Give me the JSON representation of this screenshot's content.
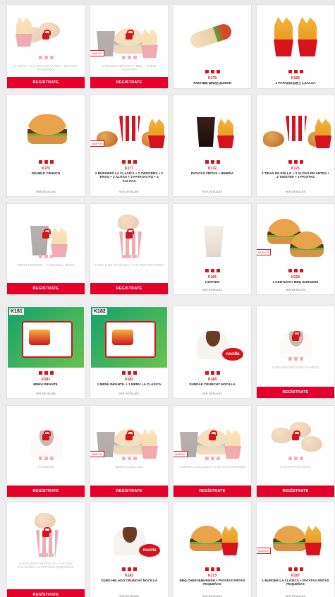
{
  "colors": {
    "accent": "#e4002b",
    "brand_red": "#d6121f",
    "background": "#eeeeee"
  },
  "register_label": "REGÍSTRATE",
  "more_info_label": "VER DETALLES",
  "new_label": "NUEVO",
  "products": [
    {
      "id": "p1",
      "code": "",
      "name": "2 TIRAS + 2 ALITAS PICANTES + PATATAS PEQUEÑAS",
      "locked": true,
      "cta": true,
      "art": "chicken-fries"
    },
    {
      "id": "p2",
      "code": "",
      "name": "2 MENÚS KENTUCKY BBQ + 2 MINI SUNDAES",
      "locked": true,
      "cta": true,
      "new": true,
      "art": "burger-meal"
    },
    {
      "id": "p3",
      "code": "K179",
      "name": "TWISTER WRAP JUNIOR",
      "locked": false,
      "cta": false,
      "art": "wrap"
    },
    {
      "id": "p4",
      "code": "K165",
      "name": "2 PATATAS GR + 1 SALSA",
      "locked": false,
      "cta": false,
      "art": "fries"
    },
    {
      "id": "p5",
      "code": "K175",
      "name": "DOUBLE CRUNCH",
      "locked": false,
      "cta": false,
      "art": "burger"
    },
    {
      "id": "p6",
      "code": "K177",
      "name": "2 BURGERS LA CLÁSICA + 2 TWISTERS + 2 TIRAS + 2 ALITAS + 2 PATATAS PQ + 2 SALSAS",
      "locked": false,
      "cta": false,
      "new": true,
      "art": "bucket-meal"
    },
    {
      "id": "p7",
      "code": "K172",
      "name": "PATATAS FRITAS + BEBIDA",
      "locked": false,
      "cta": false,
      "art": "drink-fries"
    },
    {
      "id": "p8",
      "code": "K171",
      "name": "2 TIRAS DE POLLO + 2 ALITAS PICANTES + 2 TWISTER + 2 PATATAS",
      "locked": false,
      "cta": false,
      "art": "bucket-meal"
    },
    {
      "id": "p9",
      "code": "",
      "name": "MENÚ TWISTER + 2 ORIGINAL BITES",
      "locked": true,
      "cta": true,
      "art": "drink-fries"
    },
    {
      "id": "p10",
      "code": "",
      "name": "2 TIRAS DE PECHUGA + 2 ALITAS PICANTES",
      "locked": true,
      "cta": true,
      "art": "bucket"
    },
    {
      "id": "p11",
      "code": "K166",
      "name": "1 BATIDO",
      "locked": false,
      "cta": false,
      "art": "shake"
    },
    {
      "id": "p12",
      "code": "K159",
      "name": "2 KENTUCKY BBQ BURGERS",
      "locked": false,
      "cta": false,
      "new": true,
      "art": "burgers"
    },
    {
      "id": "p13",
      "code": "K181",
      "name": "MENÚ INFANTIL",
      "locked": false,
      "cta": false,
      "art": "kids",
      "kid_tag": "K181"
    },
    {
      "id": "p14",
      "code": "K182",
      "name": "1 MENÚ INFANTIL + 1 MENÚ LA CLÁSICA",
      "locked": false,
      "cta": false,
      "art": "kids",
      "kid_tag": "K182"
    },
    {
      "id": "p15",
      "code": "K184",
      "name": "SUNDAE CRUNCHY NOCILLA",
      "locked": false,
      "cta": false,
      "art": "sundae"
    },
    {
      "id": "p16",
      "code": "",
      "name": "CUBO HELADO CON TU MENÚ",
      "locked": true,
      "cta": true,
      "art": "sundae"
    },
    {
      "id": "p17",
      "code": "",
      "name": "1 SUNDAE",
      "locked": true,
      "cta": true,
      "art": "sundae"
    },
    {
      "id": "p18",
      "code": "",
      "name": "MENÚ CHOLLAZO",
      "locked": true,
      "cta": true,
      "new": true,
      "art": "burger-meal"
    },
    {
      "id": "p19",
      "code": "",
      "name": "1 MENÚ LA CLÁSICA + 2 ALITAS PICANTES",
      "locked": true,
      "cta": true,
      "new": true,
      "art": "burger-meal"
    },
    {
      "id": "p20",
      "code": "",
      "name": "6 ALITAS PICANTES",
      "locked": true,
      "cta": true,
      "art": "chicken"
    },
    {
      "id": "p21",
      "code": "",
      "name": "6 BOCADOS DE POLLO + 2 ALITAS PICANTES + 2 PATATAS PEQUEÑAS",
      "locked": true,
      "cta": true,
      "art": "bucket"
    },
    {
      "id": "p22",
      "code": "K183",
      "name": "CUBO HELADO CRUNCHY NOCILLA",
      "locked": false,
      "cta": false,
      "art": "sundae"
    },
    {
      "id": "p23",
      "code": "K173",
      "name": "BBQ CHEESEBURGER + PATATAS FRITAS PEQUEÑAS",
      "locked": false,
      "cta": false,
      "art": "burger-fries"
    },
    {
      "id": "p24",
      "code": "K167",
      "name": "1 BURGER LA CLÁSICA + PATATAS FRITAS PEQUEÑAS",
      "locked": false,
      "cta": false,
      "new": true,
      "art": "burger-fries"
    }
  ]
}
